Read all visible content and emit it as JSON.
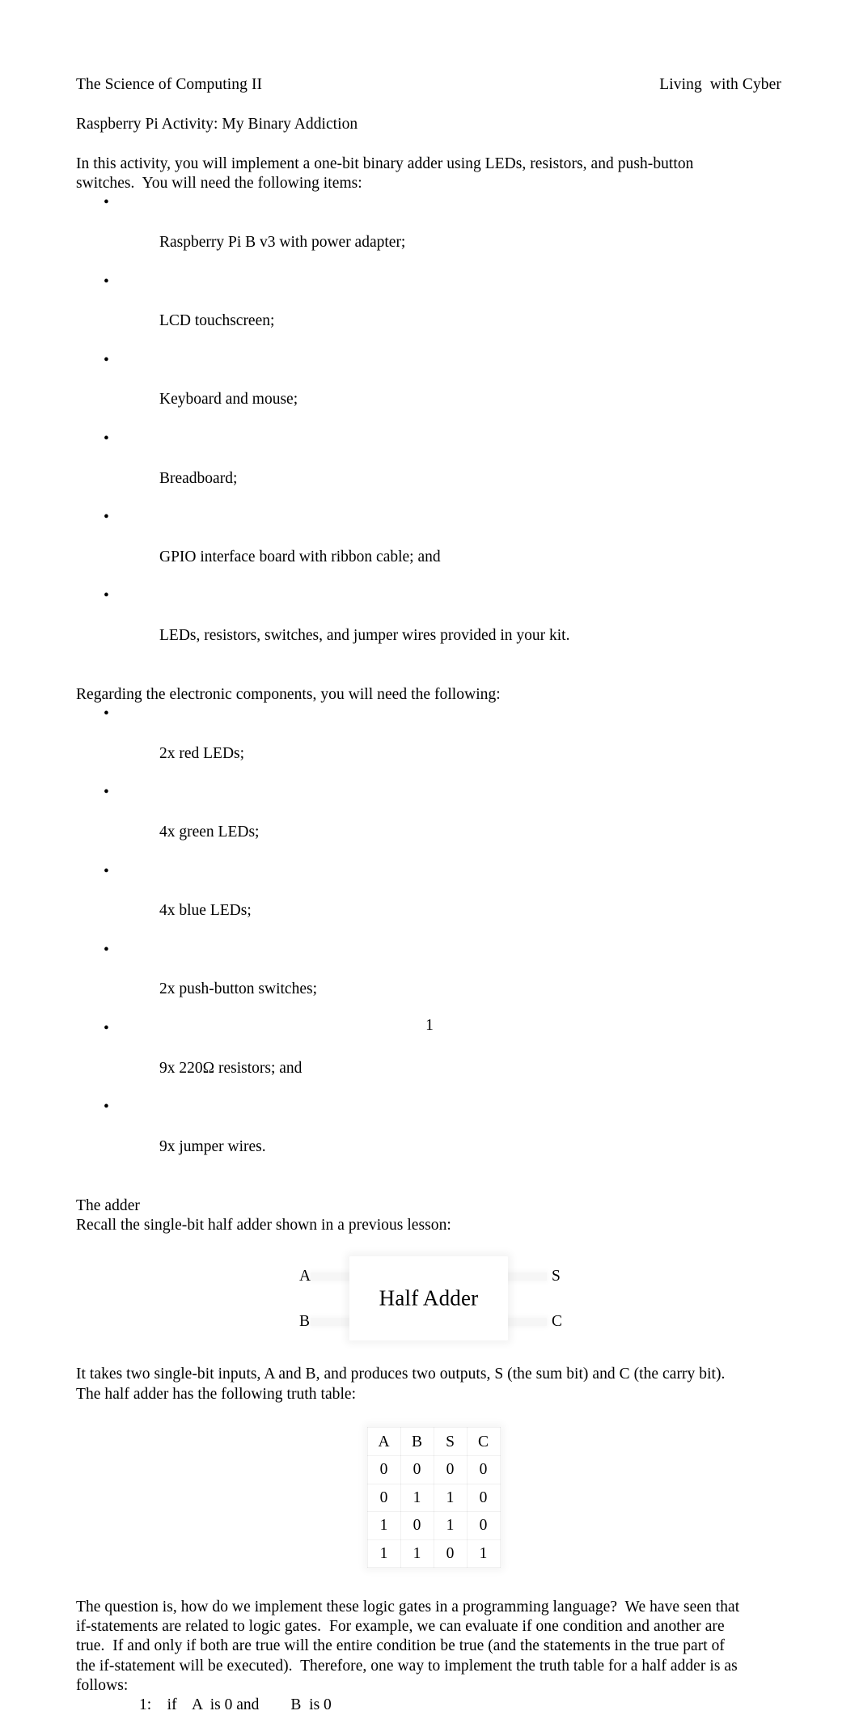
{
  "header": {
    "left": "The Science of Computing II",
    "right": "Living  with Cyber"
  },
  "activity_title": "Raspberry Pi Activity: My Binary Addiction",
  "intro": {
    "paragraph": "In this activity, you will implement a one-bit binary adder using LEDs, resistors, and push-button\nswitches.  You will need the following items:",
    "items": [
      "Raspberry Pi B v3 with power adapter;",
      "LCD touchscreen;",
      "Keyboard and mouse;",
      "Breadboard;",
      "GPIO interface board with ribbon cable; and",
      "LEDs, resistors, switches, and jumper wires provided in your kit."
    ]
  },
  "components": {
    "paragraph": "Regarding the electronic components, you will need the following:",
    "items": [
      "2x red LEDs;",
      "4x green LEDs;",
      "4x blue LEDs;",
      "2x push-button switches;",
      "9x 220Ω resistors; and",
      "9x jumper wires."
    ]
  },
  "adder_section": {
    "heading": "The adder",
    "recall": "Recall the single-bit half adder shown in a previous lesson:"
  },
  "diagram": {
    "box_label": "Half Adder",
    "input_a": "A",
    "input_b": "B",
    "output_s": "S",
    "output_c": "C"
  },
  "after_diagram": "It takes two single-bit inputs, A and B, and produces two outputs, S (the sum bit) and C (the carry bit).\nThe half adder has the following truth table:",
  "truth_table": {
    "headers": [
      "A",
      "B",
      "S",
      "C"
    ],
    "rows": [
      [
        "0",
        "0",
        "0",
        "0"
      ],
      [
        "0",
        "1",
        "1",
        "0"
      ],
      [
        "1",
        "0",
        "1",
        "0"
      ],
      [
        "1",
        "1",
        "0",
        "1"
      ]
    ]
  },
  "closing": {
    "paragraph": "The question is, how do we implement these logic gates in a programming language?  We have seen that\nif-statements are related to logic gates.  For example, we can evaluate if one condition and another are\ntrue.  If and only if both are true will the entire condition be true (and the statements in the true part of\nthe if-statement will be executed).  Therefore, one way to implement the truth table for a half adder is as\nfollows:",
    "code_line": "1:    if    A  is 0 and        B  is 0"
  },
  "page_number": "1",
  "bullet_glyph": "•",
  "colors": {
    "text": "#000000",
    "background": "#ffffff",
    "faint_line": "rgba(0,0,0,0.055)"
  }
}
